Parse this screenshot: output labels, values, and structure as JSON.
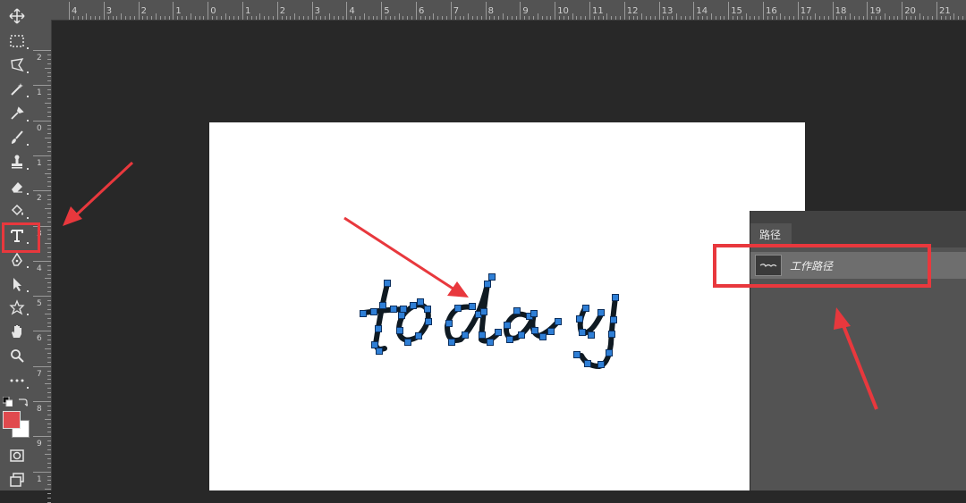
{
  "ruler": {
    "top": [
      "4",
      "3",
      "2",
      "1",
      "0",
      "1",
      "2",
      "3",
      "4",
      "5",
      "6",
      "7",
      "8",
      "9",
      "10",
      "11",
      "12",
      "13",
      "14",
      "15",
      "16",
      "17",
      "18",
      "19",
      "20",
      "21"
    ],
    "left": [
      "2",
      "1",
      "0",
      "1",
      "2",
      "3",
      "4",
      "5",
      "6",
      "7",
      "8",
      "9",
      "1"
    ]
  },
  "canvas": {
    "text": "today"
  },
  "paths_panel": {
    "tab": "路径",
    "item": "工作路径"
  },
  "tools": [
    "move-icon",
    "marquee-icon",
    "lasso-icon",
    "magic-wand-icon",
    "eyedropper-icon",
    "brush-icon",
    "stamp-icon",
    "eraser-icon",
    "paint-bucket-icon",
    "type-icon",
    "pen-icon",
    "path-select-icon",
    "shape-icon",
    "hand-icon",
    "zoom-icon",
    "more-icon",
    "swap-colors-icon",
    "color-swatches",
    "quick-mask-icon",
    "screen-mode-icon"
  ],
  "colors": {
    "foreground": "#e04a4e",
    "background": "#ffffff",
    "highlight": "#e8383d",
    "anchor": "#2f7fd6"
  }
}
